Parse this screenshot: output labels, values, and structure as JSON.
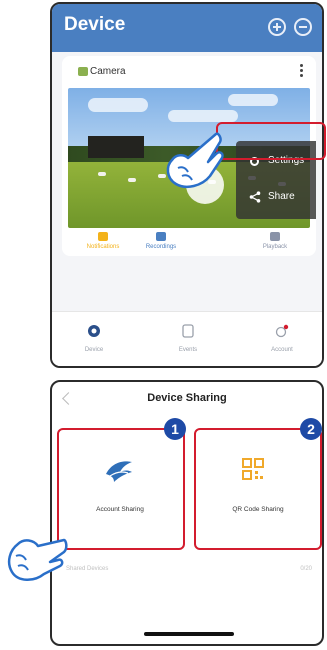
{
  "device_screen": {
    "title": "Device",
    "card": {
      "device_name": "Camera",
      "menu": {
        "settings_label": "Settings",
        "share_label": "Share"
      },
      "tabs": [
        {
          "label": "Notifications",
          "color": "#f3b21a"
        },
        {
          "label": "Recordings",
          "color": "#4a7fc1"
        },
        {
          "label": "Playback",
          "color": "#8a93a8"
        }
      ]
    },
    "bottom_nav": [
      {
        "label": "Device",
        "icon": "device-icon"
      },
      {
        "label": "Events",
        "icon": "events-icon"
      },
      {
        "label": "Account",
        "icon": "account-icon"
      }
    ]
  },
  "sharing_screen": {
    "title": "Device Sharing",
    "options": [
      {
        "label": "Account Sharing",
        "badge": "1",
        "icon": "bird-logo-icon"
      },
      {
        "label": "QR Code Sharing",
        "badge": "2",
        "icon": "qr-code-icon"
      }
    ],
    "row_label": "Shared Devices",
    "row_value": "0/20"
  },
  "colors": {
    "header_blue": "#4a7fc1",
    "highlight_red": "#d31c2e",
    "badge_blue": "#1e4aa6"
  }
}
